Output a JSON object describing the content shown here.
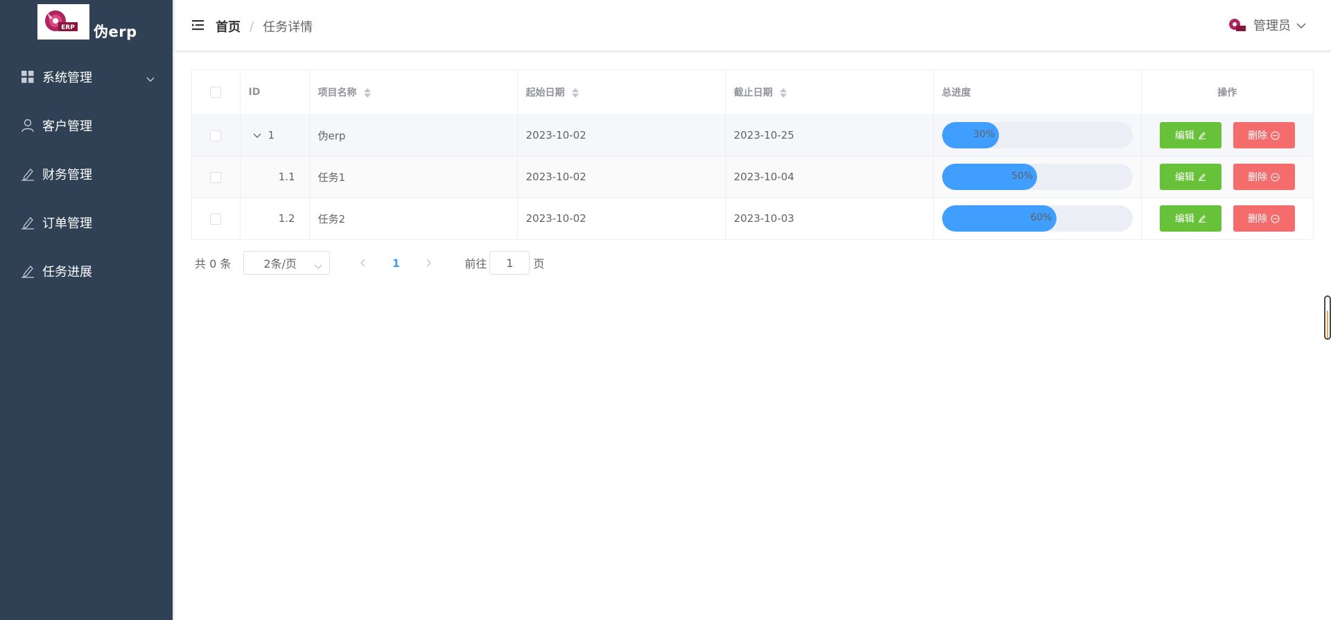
{
  "app": {
    "logo_text": "伪erp",
    "logo_badge": "ERP"
  },
  "sidebar": {
    "items": [
      {
        "label": "系统管理",
        "icon": "grid-icon",
        "has_submenu": true
      },
      {
        "label": "客户管理",
        "icon": "user-icon"
      },
      {
        "label": "财务管理",
        "icon": "edit-icon"
      },
      {
        "label": "订单管理",
        "icon": "edit-icon"
      },
      {
        "label": "任务进展",
        "icon": "edit-icon"
      }
    ]
  },
  "header": {
    "breadcrumb": {
      "home": "首页",
      "separator": "/",
      "current": "任务详情"
    },
    "user": {
      "name": "管理员"
    }
  },
  "table": {
    "columns": {
      "id": "ID",
      "name": "项目名称",
      "start": "起始日期",
      "end": "截止日期",
      "progress": "总进度",
      "actions": "操作"
    },
    "edit_label": "编辑",
    "delete_label": "删除",
    "rows": [
      {
        "id": "1",
        "name": "伪erp",
        "start": "2023-10-02",
        "end": "2023-10-25",
        "progress": 30,
        "progress_text": "30%",
        "expanded": true
      },
      {
        "id": "1.1",
        "name": "任务1",
        "start": "2023-10-02",
        "end": "2023-10-04",
        "progress": 50,
        "progress_text": "50%"
      },
      {
        "id": "1.2",
        "name": "任务2",
        "start": "2023-10-02",
        "end": "2023-10-03",
        "progress": 60,
        "progress_text": "60%"
      }
    ]
  },
  "pagination": {
    "total": "共 0 条",
    "page_size": "2条/页",
    "current_page": "1",
    "goto_prefix": "前往",
    "goto_value": "1",
    "goto_suffix": "页"
  },
  "colors": {
    "sidebar_bg": "#304156",
    "primary": "#409eff",
    "success": "#67c23a",
    "danger": "#f56c6c"
  }
}
